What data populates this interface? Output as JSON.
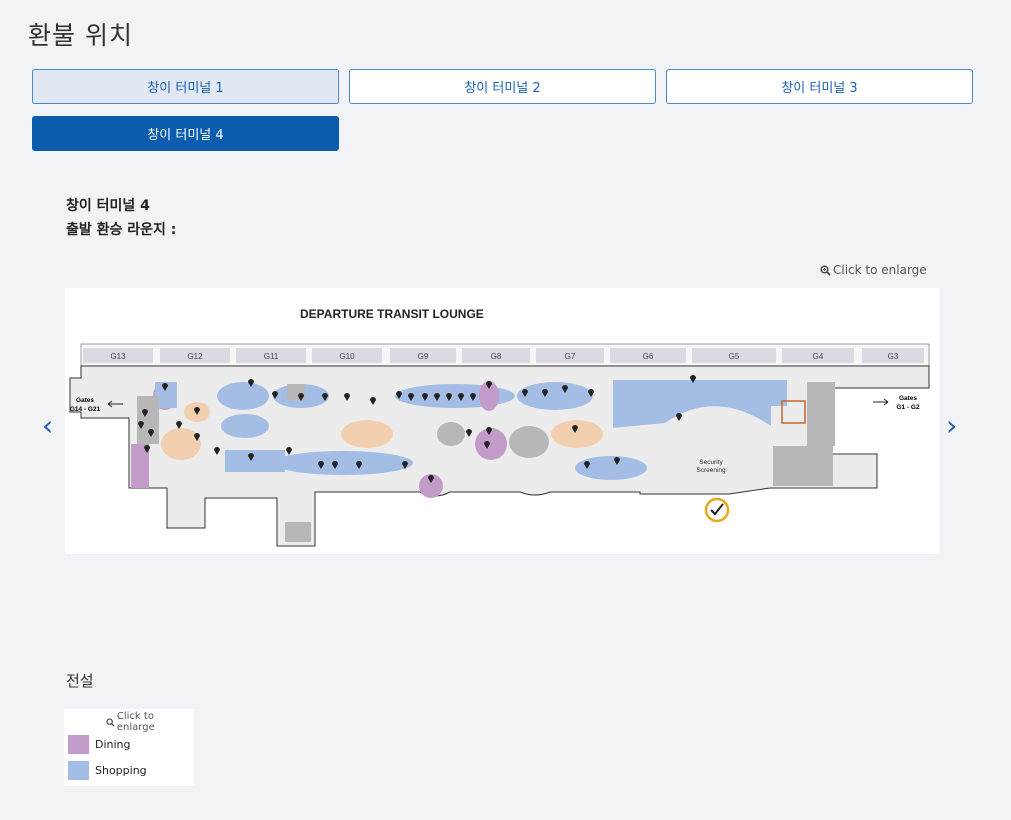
{
  "page_title": "환불 위치",
  "tabs": [
    {
      "label": "창이 터미널 1"
    },
    {
      "label": "창이 터미널 2"
    },
    {
      "label": "창이 터미널 3"
    },
    {
      "label": "창이 터미널 4"
    }
  ],
  "info": {
    "terminal": "창이 터미널 4",
    "lounge": "출발 환승 라운지 :"
  },
  "enlarge_label": "Click to enlarge",
  "map": {
    "heading": "DEPARTURE TRANSIT LOUNGE",
    "gates": [
      "G13",
      "G12",
      "G11",
      "G10",
      "G9",
      "G8",
      "G7",
      "G6",
      "G5",
      "G4",
      "G3"
    ],
    "left_gates_line1": "Gates",
    "left_gates_line2": "G14 - G21",
    "right_gates_line1": "Gates",
    "right_gates_line2": "G1 - G2",
    "security_line1": "Security",
    "security_line2": "Screening",
    "colors": {
      "dining": "#c39bc8",
      "shopping": "#a3bde5",
      "service": "#b7b7b7",
      "play": "#f2cfae"
    }
  },
  "legend": {
    "title": "전설",
    "enlarge_label": "Click to enlarge",
    "items": [
      {
        "label": "Dining",
        "color": "#c39bc8"
      },
      {
        "label": "Shopping",
        "color": "#a3bde5"
      }
    ]
  },
  "nav": {
    "prev": "‹",
    "next": "›"
  }
}
